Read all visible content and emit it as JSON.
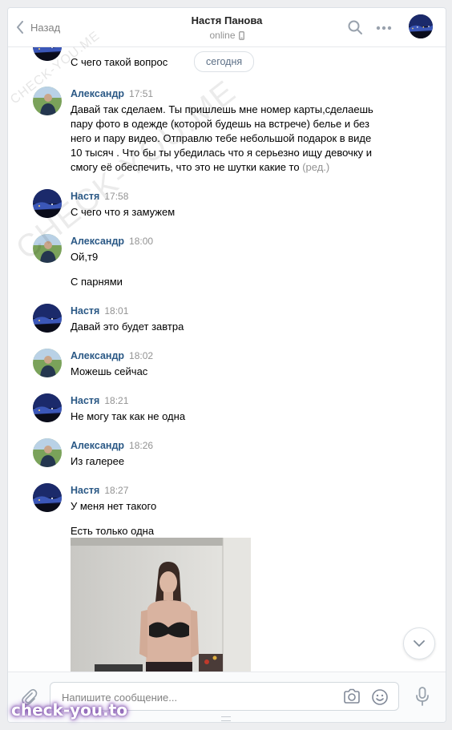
{
  "header": {
    "back_label": "Назад",
    "title": "Настя Панова",
    "status": "online"
  },
  "date_separator": "сегодня",
  "messages": [
    {
      "author": "",
      "time": "",
      "lines": [
        "С чего такой вопрос"
      ]
    },
    {
      "author": "Александр",
      "time": "17:51",
      "lines": [
        "Давай так сделаем. Ты пришлешь мне номер карты,сделаешь",
        "пару фото в одежде (которой будешь на встрече) белье и без",
        "него и пару видео. Отправлю тебе небольшой подарок в виде",
        "10 тысяч . Что бы ты убедилась что я серьезно ищу девочку и",
        "смогу её обеспечить, что это не шутки какие то"
      ],
      "edited": "(ред.)"
    },
    {
      "author": "Настя",
      "time": "17:58",
      "lines": [
        "С чего что я замужем"
      ]
    },
    {
      "author": "Александр",
      "time": "18:00",
      "lines": [
        "Ой,т9",
        "С парнями"
      ]
    },
    {
      "author": "Настя",
      "time": "18:01",
      "lines": [
        "Давай это будет завтра"
      ]
    },
    {
      "author": "Александр",
      "time": "18:02",
      "lines": [
        "Можешь сейчас"
      ]
    },
    {
      "author": "Настя",
      "time": "18:21",
      "lines": [
        "Не могу так как не одна"
      ]
    },
    {
      "author": "Александр",
      "time": "18:26",
      "lines": [
        "Из галерее"
      ]
    },
    {
      "author": "Настя",
      "time": "18:27",
      "lines": [
        "У меня нет такого",
        "Есть только одна"
      ]
    }
  ],
  "composer": {
    "placeholder": "Напишите сообщение..."
  },
  "watermarks": {
    "diagonal_small": "CHECK-YOU.ME",
    "diagonal_large": "CHECK-YOU.ME",
    "badge": "check-you.to"
  },
  "colors": {
    "author_link": "#2a5885",
    "muted": "#939393",
    "page_bg": "#edeef0"
  },
  "icons": [
    "chevron-left-icon",
    "phone-icon",
    "search-icon",
    "more-icon",
    "paperclip-icon",
    "camera-icon",
    "smile-icon",
    "microphone-icon",
    "chevron-down-icon"
  ]
}
